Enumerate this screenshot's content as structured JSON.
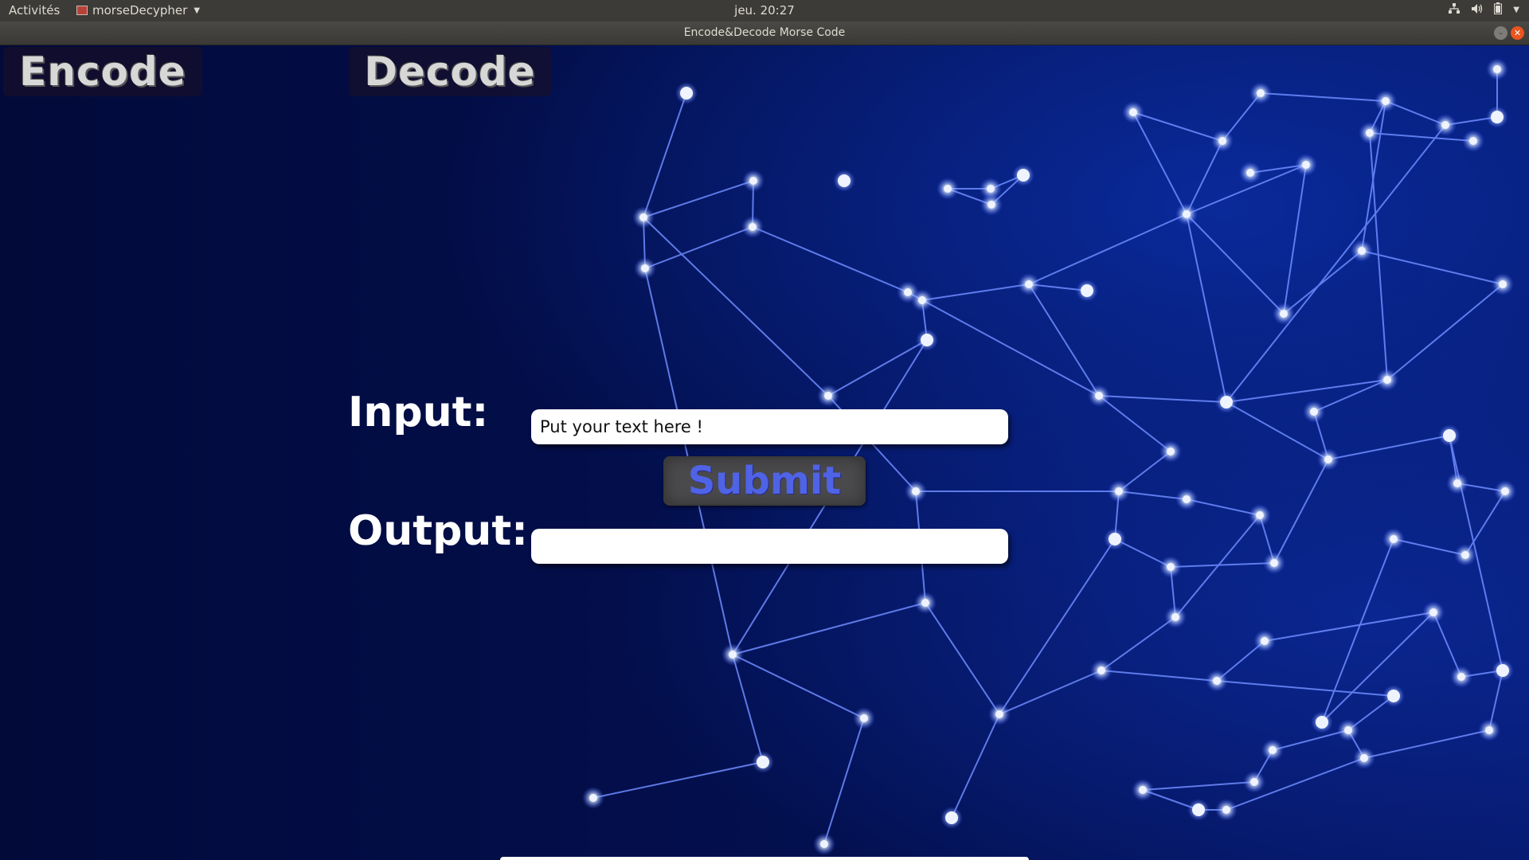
{
  "topbar": {
    "activities": "Activités",
    "app_name": "morseDecypher",
    "clock": "jeu. 20:27"
  },
  "window": {
    "title": "Encode&Decode Morse Code"
  },
  "tabs": {
    "encode": "Encode",
    "decode": "Decode"
  },
  "form": {
    "input_label": "Input:",
    "input_placeholder": "Put your text here !",
    "submit_label": "Submit",
    "output_label": "Output:",
    "output_value": ""
  },
  "colors": {
    "background": "#020a3a",
    "network_line": "#6f8cff",
    "node": "#e8eeff",
    "submit_text": "#4f63e6"
  }
}
